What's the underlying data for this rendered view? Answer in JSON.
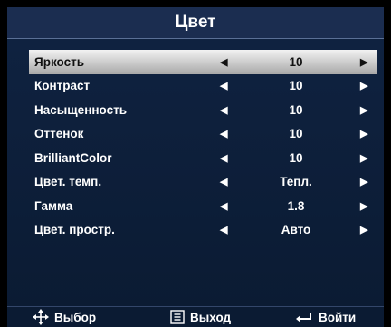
{
  "menu": {
    "title": "Цвет",
    "selected_index": 0,
    "items": [
      {
        "label": "Яркость",
        "value": "10"
      },
      {
        "label": "Контраст",
        "value": "10"
      },
      {
        "label": "Насыщенность",
        "value": "10"
      },
      {
        "label": "Оттенок",
        "value": "10"
      },
      {
        "label": "BrilliantColor",
        "value": "10"
      },
      {
        "label": "Цвет. темп.",
        "value": "Тепл."
      },
      {
        "label": "Гамма",
        "value": "1.8"
      },
      {
        "label": "Цвет. простр.",
        "value": "Авто"
      }
    ],
    "left_arrow_icon": "triangle-left-icon",
    "right_arrow_icon": "triangle-right-icon"
  },
  "footer": {
    "select_label": "Выбор",
    "select_icon": "four-way-arrows-icon",
    "exit_label": "Выход",
    "exit_icon": "menu-button-icon",
    "enter_label": "Войти",
    "enter_icon": "enter-return-arrow-icon"
  },
  "colors": {
    "title_bar": "#1b2d50",
    "panel": "#0f2240",
    "selected_row": "#d9d9d9",
    "text": "#ffffff"
  }
}
